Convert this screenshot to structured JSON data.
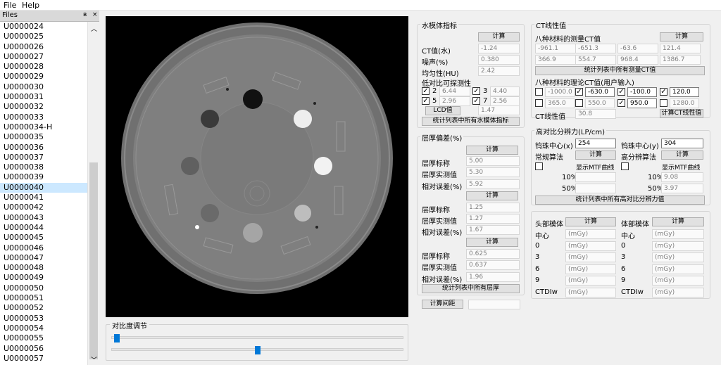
{
  "menu": {
    "file": "File",
    "help": "Help"
  },
  "dock": {
    "title": "Files",
    "float_icon": "ʙ",
    "close_icon": "×"
  },
  "files": [
    "U0000024",
    "U0000025",
    "U0000026",
    "U0000027",
    "U0000028",
    "U0000029",
    "U0000030",
    "U0000031",
    "U0000032",
    "U0000033",
    "U0000034-H",
    "U0000035",
    "U0000036",
    "U0000037",
    "U0000038",
    "U0000039",
    "U0000040",
    "U0000041",
    "U0000042",
    "U0000043",
    "U0000044",
    "U0000045",
    "U0000046",
    "U0000047",
    "U0000048",
    "U0000049",
    "U0000050",
    "U0000051",
    "U0000052",
    "U0000053",
    "U0000054",
    "U0000055",
    "U0000056",
    "U0000057"
  ],
  "selected_file": "U0000040",
  "contrast": {
    "title": "对比度调节",
    "slider1": 0.02,
    "slider2": 0.5
  },
  "water": {
    "title": "水模体指标",
    "calc": "计算",
    "ct_label": "CT值(水)",
    "ct": "-1.24",
    "noise_label": "噪声(%)",
    "noise": "0.380",
    "uniform_label": "均匀性(HU)",
    "uniform": "2.42",
    "lowc_label": "低对比可探测性",
    "c2": "2",
    "v2": "6.44",
    "c3": "3",
    "v3": "4.40",
    "c5": "5",
    "v5": "2.96",
    "c7": "7",
    "v7": "2.56",
    "lcd_btn": "LCD值",
    "lcd": "1.47",
    "stat_btn": "统计列表中所有水模体指标"
  },
  "slice": {
    "title": "层厚偏差(%)",
    "calc": "计算",
    "nominal": "层厚标称",
    "measured": "层厚实测值",
    "error": "相对误差(%)",
    "g1": [
      "5.00",
      "5.30",
      "5.92"
    ],
    "g2": [
      "1.25",
      "1.27",
      "1.67"
    ],
    "g3": [
      "0.625",
      "0.637",
      "1.96"
    ],
    "stat_btn": "统计列表中所有层厚",
    "spacing_btn": "计算间距",
    "spacing": ""
  },
  "ct_linear": {
    "title": "CT线性值",
    "measured_label": "八种材料的测量CT值",
    "calc": "计算",
    "m_row1": [
      "-961.1",
      "-651.3",
      "-63.6",
      "121.4"
    ],
    "m_row2": [
      "366.9",
      "554.7",
      "968.4",
      "1386.7"
    ],
    "stat_btn": "统计列表中所有测量CT值",
    "theory_label": "八种材料的理论CT值(用户输入)",
    "t_row1": [
      "-1000.0",
      "-630.0",
      "-100.0",
      "120.0"
    ],
    "t_row2": [
      "365.0",
      "550.0",
      "950.0",
      "1280.0"
    ],
    "t_checked1": [
      false,
      true,
      true,
      true
    ],
    "t_checked2": [
      false,
      false,
      true,
      false
    ],
    "lin_label": "CT线性值",
    "lin": "30.8",
    "lin_btn": "计算CT线性值"
  },
  "resolution": {
    "title": "高对比分辨力(LP/cm)",
    "bx_label": "钨珠中心(x)",
    "bx": "254",
    "by_label": "钨珠中心(y)",
    "by": "304",
    "normal": "常规算法",
    "high": "高分辨算法",
    "calc": "计算",
    "mtf": "显示MTF曲线",
    "p10": "10%",
    "p50": "50%",
    "hi10": "9.08",
    "hi50": "3.97",
    "stat_btn": "统计列表中所有高对比分辨力值"
  },
  "dose": {
    "head": "头部模体",
    "body": "体部模体",
    "calc": "计算",
    "rows": [
      "中心",
      "0",
      "3",
      "6",
      "9",
      "CTDIw"
    ],
    "unit": "(mGy)"
  }
}
